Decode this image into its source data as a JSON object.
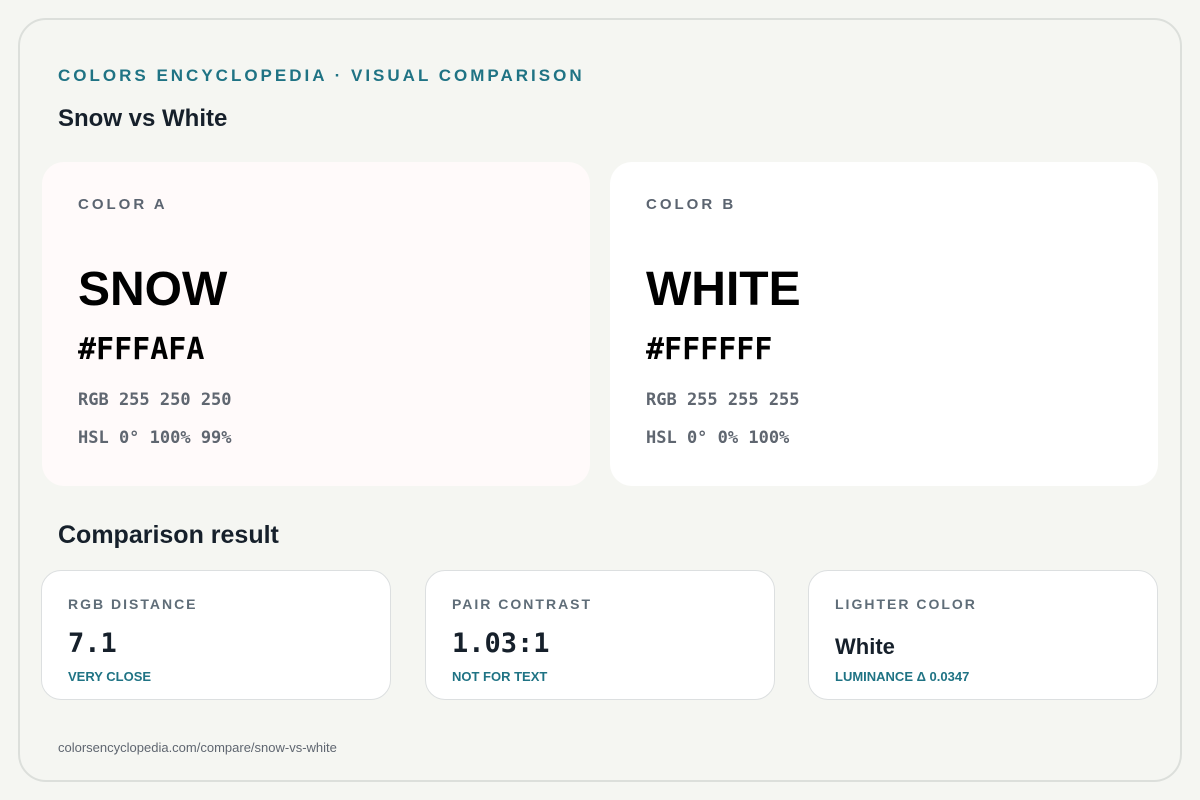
{
  "header": {
    "eyebrow": "COLORS ENCYCLOPEDIA · VISUAL COMPARISON",
    "title": "Snow vs White"
  },
  "colors": [
    {
      "label": "COLOR A",
      "name": "SNOW",
      "hex": "#FFFAFA",
      "rgb": "RGB 255 250 250",
      "hsl": "HSL 0° 100% 99%",
      "swatch_color": "#FFFAFA"
    },
    {
      "label": "COLOR B",
      "name": "WHITE",
      "hex": "#FFFFFF",
      "rgb": "RGB 255 255 255",
      "hsl": "HSL 0° 0% 100%",
      "swatch_color": "#FFFFFF"
    }
  ],
  "comparison": {
    "title": "Comparison result",
    "metrics": [
      {
        "label": "RGB DISTANCE",
        "value": "7.1",
        "note": "VERY CLOSE"
      },
      {
        "label": "PAIR CONTRAST",
        "value": "1.03:1",
        "note": "NOT FOR TEXT"
      },
      {
        "label": "LIGHTER COLOR",
        "value": "White",
        "note": "LUMINANCE Δ 0.0347"
      }
    ]
  },
  "footer": {
    "url": "colorsencyclopedia.com/compare/snow-vs-white"
  },
  "theme": {
    "accent": "#1f7384",
    "background": "#f5f6f2",
    "text": "#16202b"
  }
}
